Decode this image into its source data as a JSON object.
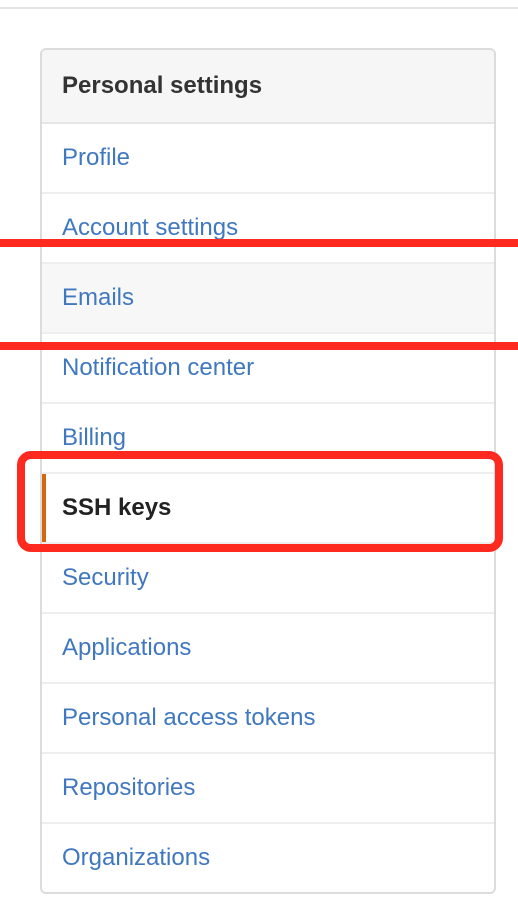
{
  "settings_menu": {
    "heading": "Personal settings",
    "items": [
      {
        "label": "Profile"
      },
      {
        "label": "Account settings"
      },
      {
        "label": "Emails"
      },
      {
        "label": "Notification center"
      },
      {
        "label": "Billing"
      },
      {
        "label": "SSH keys"
      },
      {
        "label": "Security"
      },
      {
        "label": "Applications"
      },
      {
        "label": "Personal access tokens"
      },
      {
        "label": "Repositories"
      },
      {
        "label": "Organizations"
      }
    ],
    "selected_item": "SSH keys",
    "highlighted_item": "Emails"
  },
  "colors": {
    "link": "#4078c0",
    "selected_text": "#222222",
    "selected_indicator": "#d26911",
    "heading_background": "#f6f6f6",
    "annotation_box": "#ff2a1f"
  }
}
